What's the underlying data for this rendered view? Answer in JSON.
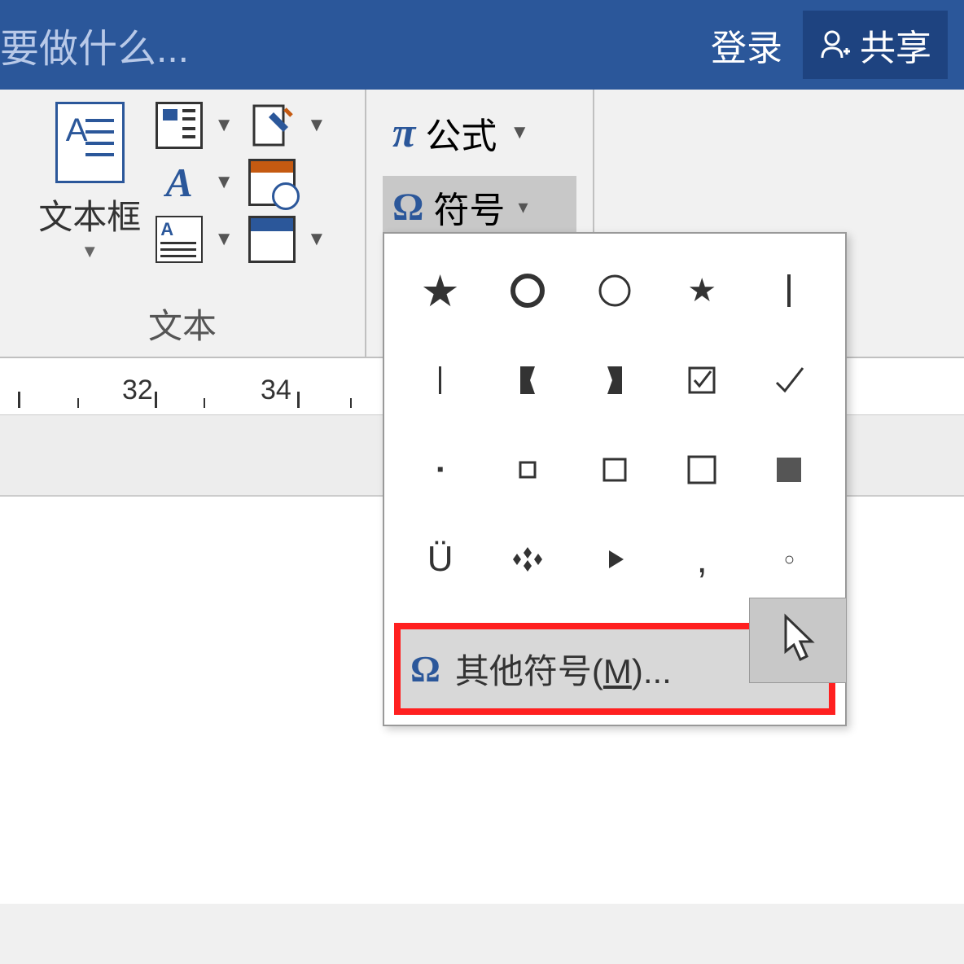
{
  "title_bar": {
    "search_placeholder": "要做什么...",
    "login_label": "登录",
    "share_label": "共享"
  },
  "ribbon": {
    "textbox_group": {
      "label": "文本",
      "textbox_label": "文本框"
    },
    "symbols_group": {
      "equation_label": "公式",
      "symbol_label": "符号"
    }
  },
  "ruler": {
    "marks": [
      "32",
      "34"
    ]
  },
  "symbol_dropdown": {
    "symbols": [
      "star-filled",
      "circle-outline-thick",
      "circle-outline",
      "star-small",
      "vertical-bar",
      "vertical-bar",
      "bracket-right",
      "bracket-left",
      "checkbox-checked",
      "checkmark",
      "small-square-filled",
      "square-small",
      "square-medium",
      "square-large",
      "square-filled",
      "u-umlaut",
      "diamond-cluster",
      "triangle-right",
      "comma",
      "small-circle"
    ],
    "more_symbols_label": "其他符号",
    "more_symbols_shortcut": "M"
  }
}
